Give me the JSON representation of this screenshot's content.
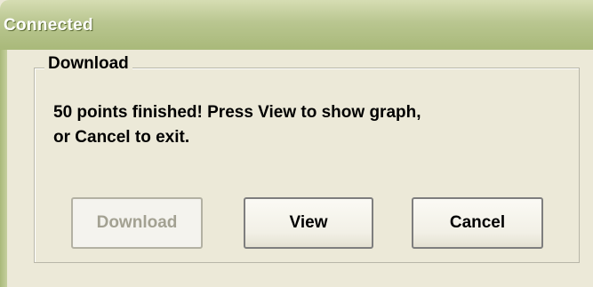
{
  "window": {
    "title": "Connected"
  },
  "group": {
    "label": "Download"
  },
  "message": {
    "line1": "50 points finished! Press View to show graph,",
    "line2": "or Cancel to exit."
  },
  "buttons": {
    "download": {
      "label": "Download",
      "enabled": false
    },
    "view": {
      "label": "View",
      "enabled": true
    },
    "cancel": {
      "label": "Cancel",
      "enabled": true
    }
  },
  "colors": {
    "titlebar": "#b9c690",
    "background": "#ece9d8",
    "disabled_text": "#a3a192"
  }
}
